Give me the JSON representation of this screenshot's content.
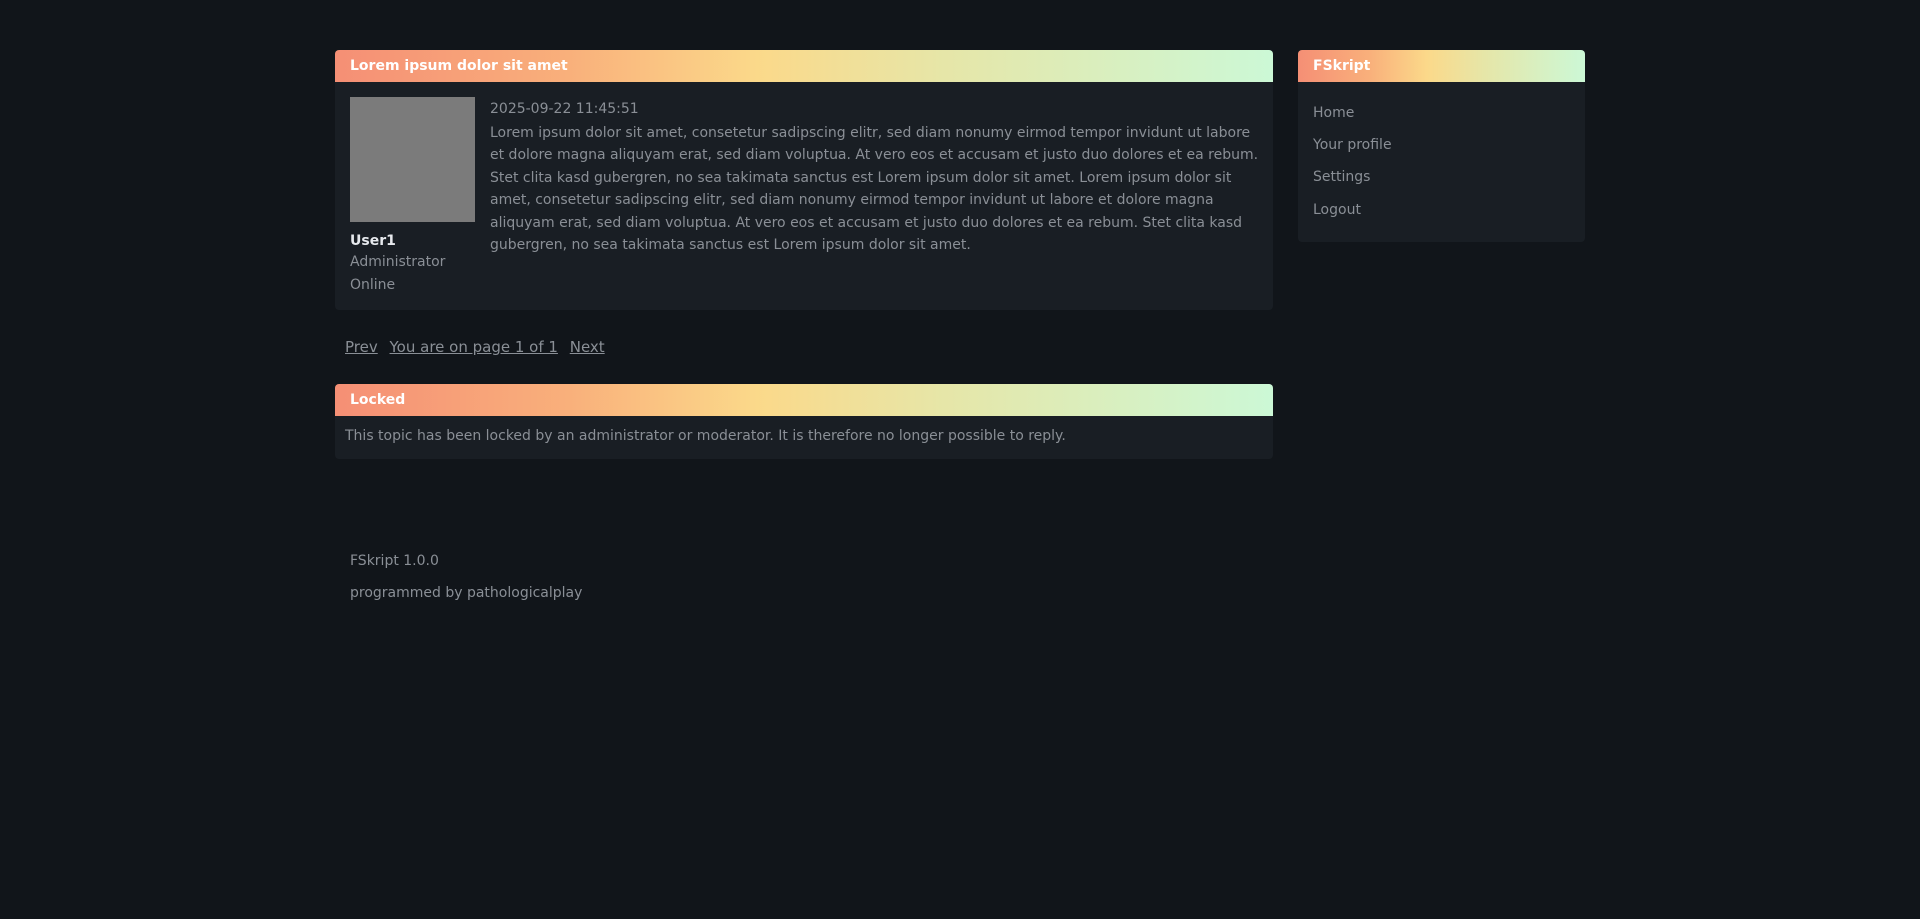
{
  "post": {
    "title": "Lorem ipsum dolor sit amet",
    "author": {
      "name": "User1",
      "role": "Administrator",
      "status": "Online"
    },
    "date": "2025-09-22 11:45:51",
    "text": "Lorem ipsum dolor sit amet, consetetur sadipscing elitr, sed diam nonumy eirmod tempor invidunt ut labore et dolore magna aliquyam erat, sed diam voluptua. At vero eos et accusam et justo duo dolores et ea rebum. Stet clita kasd gubergren, no sea takimata sanctus est Lorem ipsum dolor sit amet. Lorem ipsum dolor sit amet, consetetur sadipscing elitr, sed diam nonumy eirmod tempor invidunt ut labore et dolore magna aliquyam erat, sed diam voluptua. At vero eos et accusam et justo duo dolores et ea rebum. Stet clita kasd gubergren, no sea takimata sanctus est Lorem ipsum dolor sit amet."
  },
  "pagination": {
    "prev": "Prev",
    "info": "You are on page 1 of 1",
    "next": "Next"
  },
  "locked": {
    "title": "Locked",
    "message": "This topic has been locked by an administrator or moderator. It is therefore no longer possible to reply."
  },
  "sidebar": {
    "title": "FSkript",
    "items": [
      {
        "label": "Home"
      },
      {
        "label": "Your profile"
      },
      {
        "label": "Settings"
      },
      {
        "label": "Logout"
      }
    ]
  },
  "footer": {
    "version": "FSkript 1.0.0",
    "credit": "programmed by pathologicalplay"
  },
  "colors": {
    "background": "#11151a",
    "panel": "#191e24",
    "header_gradient": [
      "#f58f75",
      "#fbd98a",
      "#ccf8d6"
    ],
    "avatar_placeholder": "#7b7b7b"
  }
}
